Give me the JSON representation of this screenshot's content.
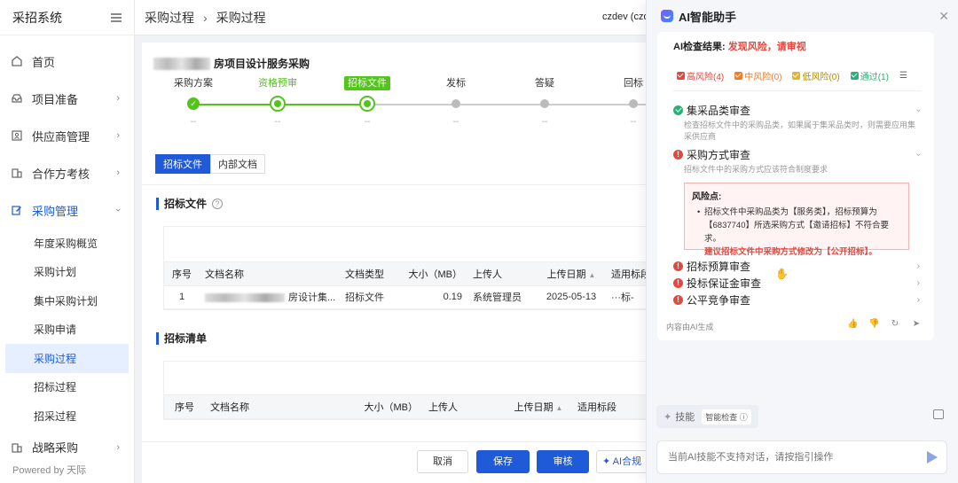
{
  "sidebar": {
    "title": "采招系统",
    "items": [
      {
        "label": "首页",
        "icon": "home-icon"
      },
      {
        "label": "项目准备",
        "icon": "inbox-icon"
      },
      {
        "label": "供应商管理",
        "icon": "id-card-icon"
      },
      {
        "label": "合作方考核",
        "icon": "building-icon"
      },
      {
        "label": "采购管理",
        "icon": "edit-icon"
      }
    ],
    "sub_items": [
      "年度采购概览",
      "采购计划",
      "集中采购计划",
      "采购申请",
      "采购过程",
      "招标过程",
      "招采过程"
    ],
    "last_item": {
      "label": "战略采购",
      "icon": "building-icon"
    },
    "powered": "Powered by 天际"
  },
  "header": {
    "crumbs": [
      "采购过程",
      "采购过程"
    ],
    "user": "czdev (czd"
  },
  "main": {
    "project_title": "房项目设计服务采购",
    "steps": [
      {
        "label": "采购方案",
        "sub": "--",
        "state": "done"
      },
      {
        "label": "资格预审",
        "sub": "--",
        "state": "done"
      },
      {
        "label": "招标文件",
        "sub": "--",
        "state": "current"
      },
      {
        "label": "发标",
        "sub": "--",
        "state": "todo"
      },
      {
        "label": "答疑",
        "sub": "--",
        "state": "todo"
      },
      {
        "label": "回标",
        "sub": "--",
        "state": "todo"
      }
    ],
    "tabs": [
      "招标文件",
      "内部文档"
    ],
    "section1": "招标文件",
    "table1": {
      "headers": [
        "序号",
        "文档名称",
        "文档类型",
        "大小（MB）",
        "上传人",
        "上传日期",
        "适用标段"
      ],
      "rows": [
        [
          "1",
          "房设计集...",
          "招标文件",
          "0.19",
          "系统管理员",
          "2025-05-13",
          "···标-"
        ]
      ]
    },
    "section2": "招标清单",
    "table2": {
      "headers": [
        "序号",
        "文档名称",
        "大小（MB）",
        "上传人",
        "上传日期",
        "适用标段"
      ]
    },
    "buttons": {
      "cancel": "取消",
      "save": "保存",
      "review": "审核",
      "ai": "AI合规"
    }
  },
  "ai": {
    "title": "AI智能助手",
    "result_label": "AI检查结果:",
    "result_value": "发现风险，请审视",
    "filters": [
      {
        "label": "高风险(4)",
        "color": "#e8453c",
        "text_color": "#e8453c"
      },
      {
        "label": "中风险(0)",
        "color": "#f07c2c",
        "text_color": "#f07c2c"
      },
      {
        "label": "低风险(0)",
        "color": "#e6b422",
        "text_color": "#b38a00"
      },
      {
        "label": "通过(1)",
        "color": "#22b573",
        "text_color": "#22b573"
      }
    ],
    "checks": [
      {
        "title": "集采品类审查",
        "desc": "检查招标文件中的采购品类，如果属于集采品类时，则需要应用集采供应商",
        "status": "pass"
      },
      {
        "title": "采购方式审查",
        "desc": "招标文件中的采购方式应该符合制度要求",
        "status": "risk"
      },
      {
        "title": "招标预算审查",
        "status": "risk"
      },
      {
        "title": "投标保证金审查",
        "status": "risk"
      },
      {
        "title": "公平竞争审查",
        "status": "risk"
      }
    ],
    "risk_box": {
      "head": "风险点:",
      "text": "招标文件中采购品类为【服务类】，招标预算为【6837740】所选采购方式【邀请招标】不符合要求。",
      "suggestion": "建议招标文件中采购方式修改为【公开招标】。"
    },
    "footer": "内容由AI生成",
    "skill_label": "技能",
    "skill_tag": "智能检查",
    "input_placeholder": "当前AI技能不支持对话，请按指引操作"
  }
}
